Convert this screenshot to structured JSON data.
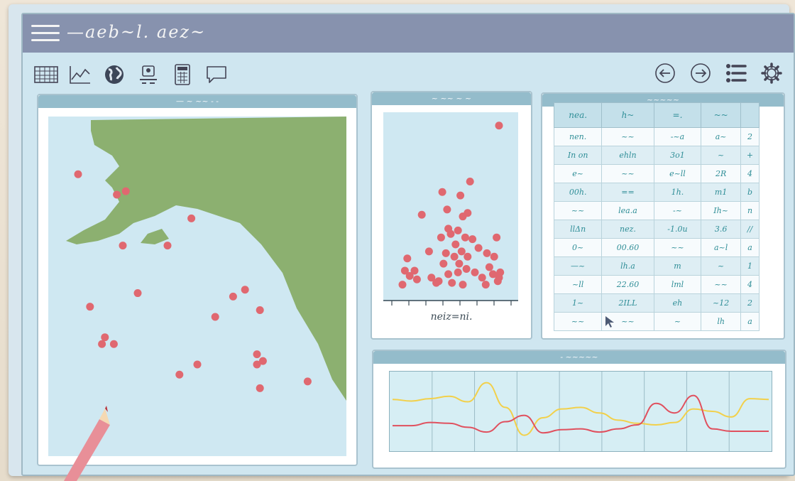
{
  "app": {
    "title": "—aeb~l. aez~"
  },
  "toolbar": {
    "left_icons": [
      "table-icon",
      "line-chart-icon",
      "globe-icon",
      "user-desk-icon",
      "calculator-icon",
      "chat-icon"
    ],
    "right_icons": [
      "back-icon",
      "forward-icon",
      "list-icon",
      "gear-icon"
    ]
  },
  "map_panel": {
    "title": "— ~ ~~ - -",
    "land_color": "#8cb070",
    "water_color": "#cfe8f2",
    "point_color": "#e06870",
    "points": [
      {
        "lon": 0.1,
        "lat": 0.17
      },
      {
        "lon": 0.23,
        "lat": 0.23
      },
      {
        "lon": 0.26,
        "lat": 0.22
      },
      {
        "lon": 0.48,
        "lat": 0.3
      },
      {
        "lon": 0.25,
        "lat": 0.38
      },
      {
        "lon": 0.4,
        "lat": 0.38
      },
      {
        "lon": 0.3,
        "lat": 0.52
      },
      {
        "lon": 0.14,
        "lat": 0.56
      },
      {
        "lon": 0.62,
        "lat": 0.53
      },
      {
        "lon": 0.66,
        "lat": 0.51
      },
      {
        "lon": 0.56,
        "lat": 0.59
      },
      {
        "lon": 0.71,
        "lat": 0.57
      },
      {
        "lon": 0.19,
        "lat": 0.65
      },
      {
        "lon": 0.18,
        "lat": 0.67
      },
      {
        "lon": 0.22,
        "lat": 0.67
      },
      {
        "lon": 0.7,
        "lat": 0.7
      },
      {
        "lon": 0.72,
        "lat": 0.72
      },
      {
        "lon": 0.7,
        "lat": 0.73
      },
      {
        "lon": 0.5,
        "lat": 0.73
      },
      {
        "lon": 0.44,
        "lat": 0.76
      },
      {
        "lon": 0.71,
        "lat": 0.8
      },
      {
        "lon": 0.87,
        "lat": 0.78
      }
    ]
  },
  "scatter_panel": {
    "title": "~ ~~ ~ ~",
    "xlabel": "neiz=ni.",
    "point_color": "#e06870",
    "chart_data": {
      "type": "scatter",
      "xlim": [
        0,
        10
      ],
      "ylim": [
        0,
        10
      ],
      "points": [
        [
          9.0,
          9.4
        ],
        [
          2.6,
          4.3
        ],
        [
          6.6,
          6.2
        ],
        [
          5.8,
          5.4
        ],
        [
          4.3,
          5.6
        ],
        [
          4.7,
          4.6
        ],
        [
          6.0,
          4.2
        ],
        [
          6.4,
          4.4
        ],
        [
          4.8,
          3.5
        ],
        [
          5.6,
          3.4
        ],
        [
          6.2,
          3.0
        ],
        [
          5.0,
          3.2
        ],
        [
          4.2,
          3.0
        ],
        [
          5.4,
          2.6
        ],
        [
          6.8,
          2.9
        ],
        [
          3.2,
          2.2
        ],
        [
          1.4,
          1.8
        ],
        [
          2.0,
          1.1
        ],
        [
          4.6,
          2.1
        ],
        [
          5.3,
          1.9
        ],
        [
          5.9,
          2.2
        ],
        [
          6.4,
          1.9
        ],
        [
          7.3,
          2.4
        ],
        [
          8.0,
          2.1
        ],
        [
          8.8,
          3.0
        ],
        [
          8.6,
          1.9
        ],
        [
          1.2,
          1.1
        ],
        [
          1.6,
          0.8
        ],
        [
          2.2,
          0.6
        ],
        [
          3.4,
          0.7
        ],
        [
          4.0,
          0.5
        ],
        [
          4.8,
          0.9
        ],
        [
          5.6,
          1.0
        ],
        [
          6.3,
          1.2
        ],
        [
          7.0,
          1.0
        ],
        [
          7.6,
          0.7
        ],
        [
          8.2,
          1.3
        ],
        [
          8.5,
          0.9
        ],
        [
          9.0,
          0.7
        ],
        [
          1.0,
          0.3
        ],
        [
          3.8,
          0.4
        ],
        [
          5.1,
          0.4
        ],
        [
          6.0,
          0.3
        ],
        [
          7.9,
          0.3
        ],
        [
          8.9,
          0.5
        ],
        [
          4.4,
          1.5
        ],
        [
          5.7,
          1.5
        ],
        [
          9.1,
          1.0
        ]
      ]
    }
  },
  "table_panel": {
    "title": "~~~~~",
    "columns": [
      "nea.",
      "h~",
      "=.",
      "~~"
    ],
    "rows": [
      [
        "nen.",
        "~~",
        "-~a",
        "a~",
        "2"
      ],
      [
        "In on",
        "ehln",
        "3o1",
        "~",
        "+"
      ],
      [
        "e~",
        "~~",
        "e~ll",
        "2R",
        "4"
      ],
      [
        "00h.",
        "==",
        "1h.",
        "m1",
        "b"
      ],
      [
        "~~",
        "lea.a",
        "-~",
        "Ih~",
        "n"
      ],
      [
        "llΔn",
        "nez.",
        "-1.0u",
        "3.6",
        "//"
      ],
      [
        "0~",
        "00.60",
        "~~",
        "a~l",
        "a"
      ],
      [
        "—~",
        "lh.a",
        "m",
        "~",
        "1"
      ],
      [
        "~ll",
        "22.60",
        "lml",
        "~~",
        "4"
      ],
      [
        "1~",
        "2ILL",
        "eh",
        "~12",
        "2"
      ],
      [
        "~~",
        "~~",
        "~",
        "lh",
        "a"
      ]
    ]
  },
  "line_panel": {
    "title": "- ~~~~~",
    "chart_data": {
      "type": "line",
      "x": [
        0,
        1,
        2,
        3,
        4,
        5,
        6,
        7,
        8,
        9,
        10,
        11,
        12,
        13,
        14,
        15,
        16,
        17,
        18,
        19,
        20
      ],
      "ylim": [
        0,
        10
      ],
      "series": [
        {
          "color": "#f2d04a",
          "values": [
            6.5,
            6.3,
            6.6,
            6.9,
            6.2,
            8.6,
            5.5,
            2.0,
            4.2,
            5.3,
            5.5,
            4.8,
            3.9,
            3.5,
            3.3,
            3.6,
            5.3,
            5.0,
            4.3,
            6.6,
            6.5
          ]
        },
        {
          "color": "#e0505e",
          "values": [
            3.2,
            3.2,
            3.6,
            3.5,
            3.0,
            2.4,
            3.7,
            4.5,
            2.3,
            2.7,
            2.8,
            2.4,
            2.8,
            3.3,
            6.0,
            4.8,
            7.0,
            2.8,
            2.5,
            2.5,
            2.5
          ]
        }
      ]
    }
  }
}
